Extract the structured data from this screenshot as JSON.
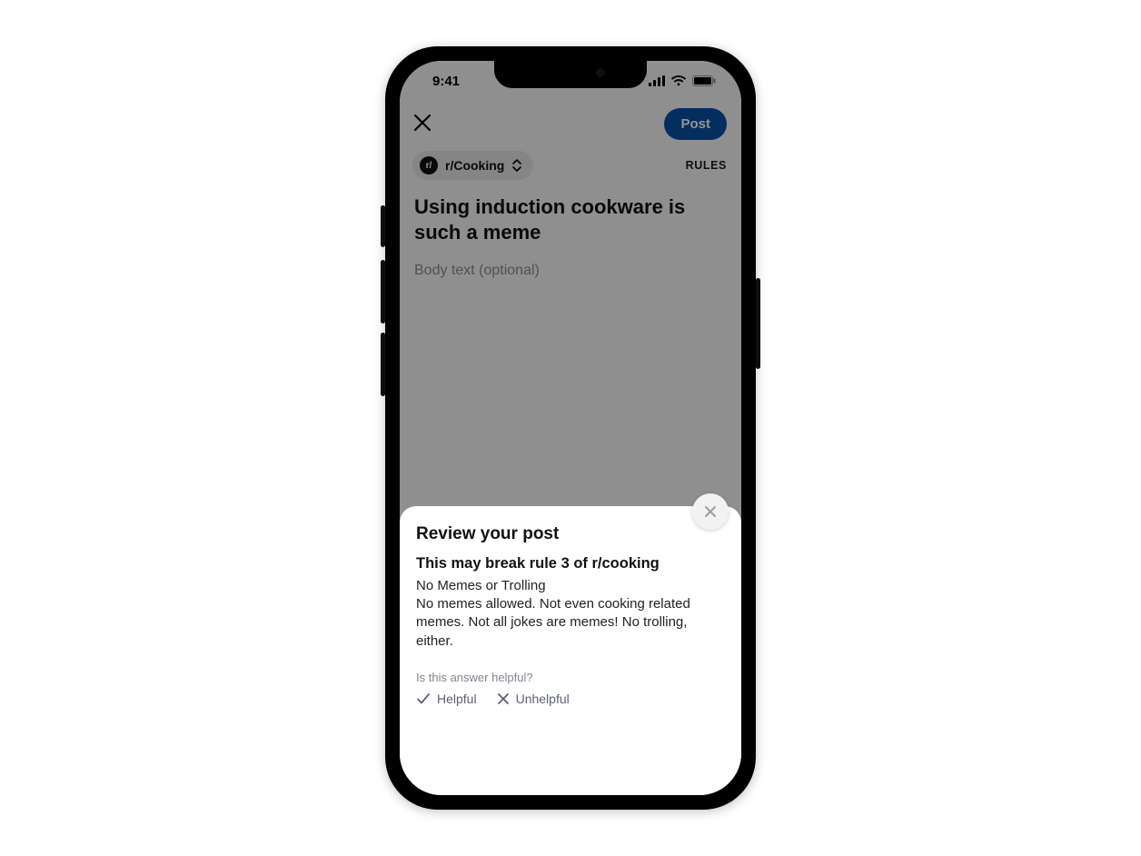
{
  "status": {
    "time": "9:41"
  },
  "compose": {
    "close_label": "Close",
    "post_button": "Post",
    "community_prefix": "r/",
    "community_name": "r/Cooking",
    "rules_link": "RULES",
    "title_text": "Using induction cookware is such a meme",
    "body_placeholder": "Body text (optional)"
  },
  "sheet": {
    "heading": "Review your post",
    "warning": "This may break rule 3 of r/cooking",
    "rule_title": "No Memes or Trolling",
    "rule_desc": "No memes allowed. Not even cooking related memes. Not all jokes are memes! No trolling, either.",
    "feedback_prompt": "Is this answer helpful?",
    "helpful_label": "Helpful",
    "unhelpful_label": "Unhelpful",
    "close_label": "Dismiss"
  }
}
